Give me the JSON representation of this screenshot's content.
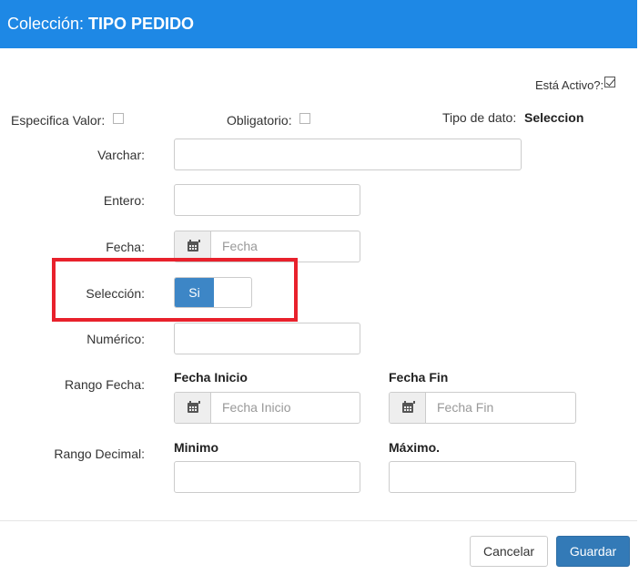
{
  "header": {
    "prefix": "Colección:",
    "title": "TIPO PEDIDO"
  },
  "flags": {
    "activo_label": "Está Activo?:",
    "activo_checked": true,
    "especifica_label": "Especifica Valor:",
    "especifica_checked": false,
    "obligatorio_label": "Obligatorio:",
    "obligatorio_checked": false,
    "tipo_label": "Tipo de dato:",
    "tipo_value": "Seleccion"
  },
  "fields": {
    "varchar_label": "Varchar:",
    "entero_label": "Entero:",
    "fecha_label": "Fecha:",
    "fecha_placeholder": "Fecha",
    "seleccion_label": "Selección:",
    "seleccion_toggle": "Si",
    "numerico_label": "Numérico:",
    "rango_fecha_label": "Rango Fecha:",
    "fecha_inicio_heading": "Fecha Inicio",
    "fecha_inicio_placeholder": "Fecha Inicio",
    "fecha_fin_heading": "Fecha Fin",
    "fecha_fin_placeholder": "Fecha Fin",
    "rango_decimal_label": "Rango Decimal:",
    "minimo_heading": "Minimo",
    "maximo_heading": "Máximo."
  },
  "footer": {
    "cancel": "Cancelar",
    "save": "Guardar"
  },
  "colors": {
    "header": "#1e88e5",
    "primary": "#337ab7",
    "highlight": "#e8212c"
  }
}
